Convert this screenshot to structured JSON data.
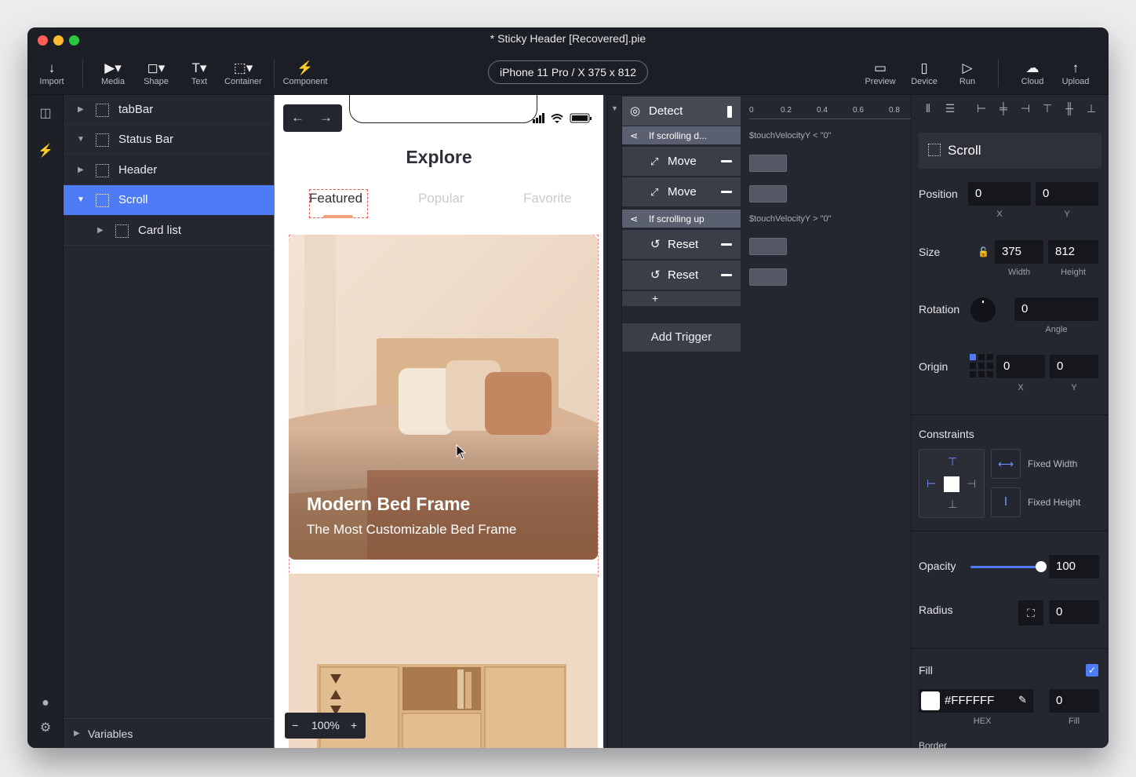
{
  "window": {
    "title": "* Sticky Header [Recovered].pie"
  },
  "toolbar": {
    "import": "Import",
    "media": "Media",
    "shape": "Shape",
    "text": "Text",
    "container": "Container",
    "component": "Component",
    "device": "iPhone 11 Pro / X  375 x 812",
    "preview": "Preview",
    "device_btn": "Device",
    "run": "Run",
    "cloud": "Cloud",
    "upload": "Upload"
  },
  "layers": {
    "items": [
      {
        "label": "tabBar"
      },
      {
        "label": "Status Bar"
      },
      {
        "label": "Header"
      },
      {
        "label": "Scroll"
      },
      {
        "label": "Card list"
      }
    ],
    "variables": "Variables"
  },
  "canvas": {
    "header_title": "Explore",
    "tabs": [
      "Featured",
      "Popular",
      "Favorite"
    ],
    "card1_title": "Modern Bed Frame",
    "card1_subtitle": "The Most Customizable Bed Frame",
    "zoom": "100%"
  },
  "interactions": {
    "detect": "Detect",
    "trigger1": "If scrolling d...",
    "trigger1_cond": "$touchVelocityY < \"0\"",
    "move": "Move",
    "trigger2": "If scrolling up",
    "trigger2_cond": "$touchVelocityY > \"0\"",
    "reset": "Reset",
    "add_trigger": "Add Trigger",
    "ruler": [
      "0",
      "0.2",
      "0.4",
      "0.6",
      "0.8"
    ]
  },
  "properties": {
    "layer_name": "Scroll",
    "position_label": "Position",
    "x": "0",
    "y": "0",
    "x_label": "X",
    "y_label": "Y",
    "size_label": "Size",
    "width": "375",
    "height": "812",
    "width_label": "Width",
    "height_label": "Height",
    "rotation_label": "Rotation",
    "angle": "0",
    "angle_label": "Angle",
    "origin_label": "Origin",
    "origin_x": "0",
    "origin_y": "0",
    "constraints_label": "Constraints",
    "fixed_width": "Fixed Width",
    "fixed_height": "Fixed Height",
    "opacity_label": "Opacity",
    "opacity": "100",
    "opacity_level": 100,
    "radius_label": "Radius",
    "radius": "0",
    "fill_label": "Fill",
    "fill_checked": true,
    "fill_hex": "#FFFFFF",
    "fill_value": "0",
    "hex_label": "HEX",
    "fill_sub": "Fill",
    "border_label": "Border"
  },
  "colors": {
    "accent": "#4E7CF6",
    "tab_underline": "#F0A07A"
  }
}
